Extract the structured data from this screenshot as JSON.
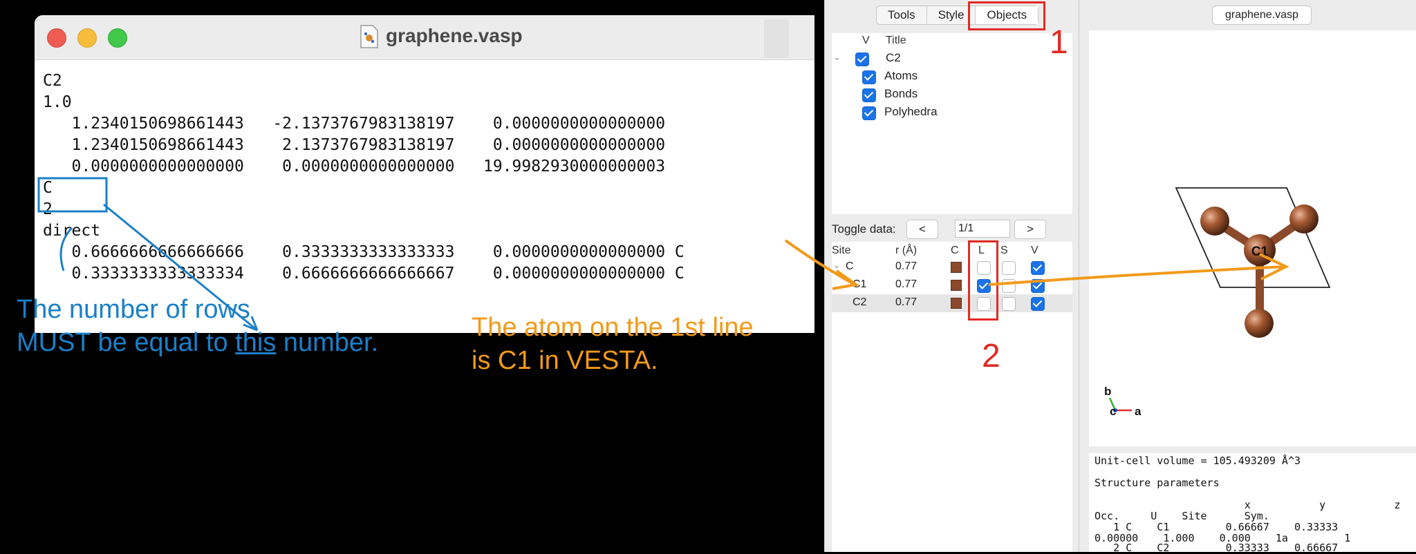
{
  "editor": {
    "title": "graphene.vasp",
    "lines": [
      "C2",
      "1.0",
      "   1.2340150698661443   -2.1373767983138197    0.0000000000000000",
      "   1.2340150698661443    2.1373767983138197    0.0000000000000000",
      "   0.0000000000000000    0.0000000000000000   19.9982930000000003",
      "C",
      "2",
      "direct",
      "   0.6666666666666666    0.3333333333333333    0.0000000000000000 C",
      "   0.3333333333333334    0.6666666666666667    0.0000000000000000 C"
    ]
  },
  "annotations": {
    "blue_line1": "The number of rows",
    "blue_line2_a": "MUST be equal to ",
    "blue_line2_u": "this",
    "blue_line2_b": " number.",
    "orange_line1": "The atom on the 1st line",
    "orange_line2": "is C1 in VESTA.",
    "num1": "1",
    "num2": "2",
    "colors": {
      "blue": "#1a7fc8",
      "orange": "#f29a1a",
      "red": "#e02a23"
    }
  },
  "vesta": {
    "tabs": [
      "Tools",
      "Style",
      "Objects"
    ],
    "selected_tab": "Objects",
    "tree": {
      "headers": {
        "v": "V",
        "title": "Title"
      },
      "root": "C2",
      "items": [
        "Atoms",
        "Bonds",
        "Polyhedra"
      ]
    },
    "toggle": {
      "label": "Toggle data:",
      "prev": "<",
      "page": "1/1",
      "next": ">"
    },
    "site_table": {
      "headers": [
        "Site",
        "r (Å)",
        "C",
        "L",
        "S",
        "V"
      ],
      "rows": [
        {
          "site": "C",
          "r": "0.77",
          "L": false,
          "S": false,
          "V": true
        },
        {
          "site": "C1",
          "r": "0.77",
          "L": true,
          "S": false,
          "V": true
        },
        {
          "site": "C2",
          "r": "0.77",
          "L": false,
          "S": false,
          "V": true
        }
      ],
      "atom_color": "#8b4a2b"
    },
    "file_tab": "graphene.vasp",
    "viewport": {
      "atom_label": "C1",
      "axes": {
        "b": "b",
        "c": "c",
        "a": "a"
      }
    },
    "output_lines": [
      "Unit-cell volume = 105.493209 Å^3",
      "",
      "Structure parameters",
      "",
      "                        x           y           z",
      "Occ.     U    Site      Sym.",
      "   1 C    C1         0.66667    0.33333",
      "0.00000    1.000    0.000    1a         1",
      "   2 C    C2         0.33333    0.66667"
    ]
  }
}
